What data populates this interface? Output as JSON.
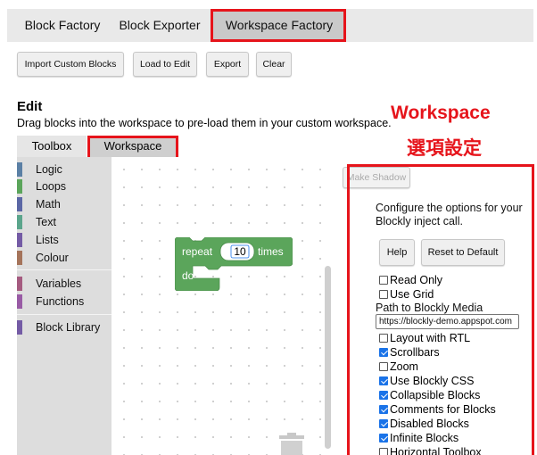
{
  "top_tabs": [
    "Block Factory",
    "Block Exporter",
    "Workspace Factory"
  ],
  "toolbar": {
    "import_label": "Import Custom Blocks",
    "load_label": "Load to Edit",
    "export_label": "Export",
    "clear_label": "Clear"
  },
  "edit": {
    "title": "Edit",
    "description": "Drag blocks into the workspace to pre-load them in your custom workspace."
  },
  "annotation": {
    "line1": "Workspace",
    "line2": "選項設定"
  },
  "sub_tabs": [
    "Toolbox",
    "Workspace"
  ],
  "toolbox": {
    "categories": [
      {
        "label": "Logic",
        "color": "#5b80a5"
      },
      {
        "label": "Loops",
        "color": "#5ba55b"
      },
      {
        "label": "Math",
        "color": "#5b67a5"
      },
      {
        "label": "Text",
        "color": "#5ba58c"
      },
      {
        "label": "Lists",
        "color": "#745ba5"
      },
      {
        "label": "Colour",
        "color": "#a5745b"
      },
      {
        "label": "Variables",
        "color": "#a55b80"
      },
      {
        "label": "Functions",
        "color": "#995ba5"
      },
      {
        "label": "Block Library",
        "color": "#745ba5"
      }
    ]
  },
  "block": {
    "repeat_label": "repeat",
    "count_value": "10",
    "times_label": "times",
    "do_label": "do",
    "color": "#5ba55b"
  },
  "options_panel": {
    "make_shadow_label": "Make Shadow",
    "description_line1": "Configure the options for your",
    "description_line2": "Blockly inject call.",
    "help_label": "Help",
    "reset_label": "Reset to Default",
    "path_label": "Path to Blockly Media",
    "path_value": "https://blockly-demo.appspot.com",
    "checks_a": [
      {
        "label": "Read Only",
        "checked": false
      },
      {
        "label": "Use Grid",
        "checked": false
      }
    ],
    "checks_b": [
      {
        "label": "Layout with RTL",
        "checked": false
      },
      {
        "label": "Scrollbars",
        "checked": true
      },
      {
        "label": "Zoom",
        "checked": false
      },
      {
        "label": "Use Blockly CSS",
        "checked": true
      },
      {
        "label": "Collapsible Blocks",
        "checked": true
      },
      {
        "label": "Comments for Blocks",
        "checked": true
      },
      {
        "label": "Disabled Blocks",
        "checked": true
      },
      {
        "label": "Infinite Blocks",
        "checked": true
      },
      {
        "label": "Horizontal Toolbox",
        "checked": false
      }
    ]
  },
  "colors": {
    "highlight": "#e6141b",
    "accent": "#1a73e8"
  }
}
